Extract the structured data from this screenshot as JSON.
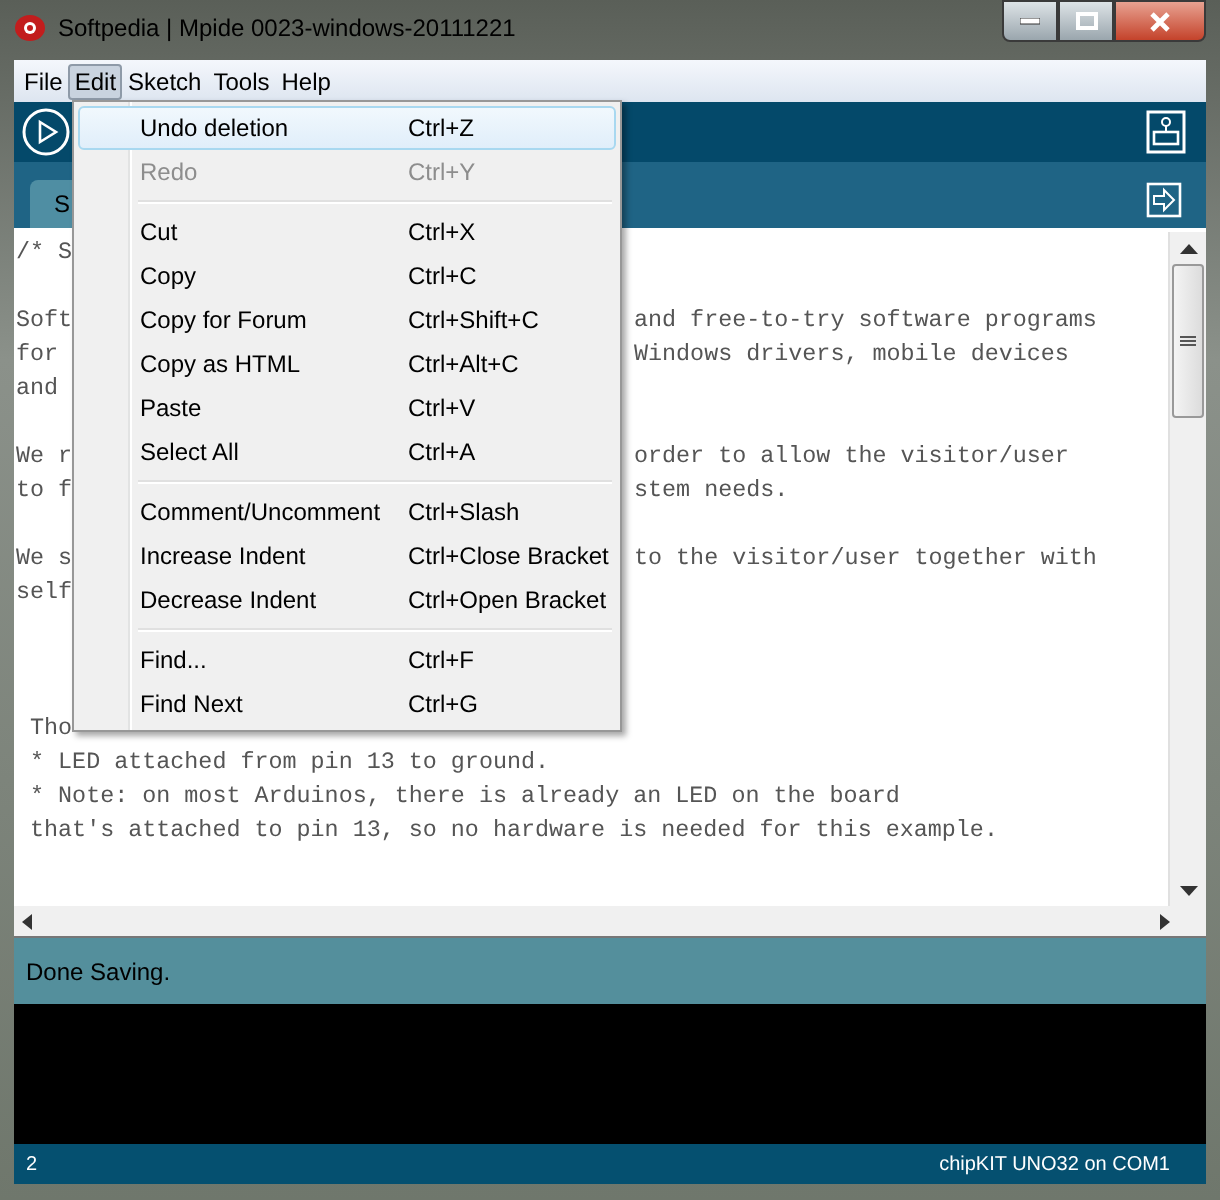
{
  "window": {
    "title": "Softpedia | Mpide 0023-windows-20111221"
  },
  "menubar": [
    {
      "label": "File",
      "selected": false
    },
    {
      "label": "Edit",
      "selected": true
    },
    {
      "label": "Sketch",
      "selected": false
    },
    {
      "label": "Tools",
      "selected": false
    },
    {
      "label": "Help",
      "selected": false
    }
  ],
  "edit_menu": {
    "groups": [
      [
        {
          "label": "Undo deletion",
          "shortcut": "Ctrl+Z",
          "disabled": false,
          "selected": true
        },
        {
          "label": "Redo",
          "shortcut": "Ctrl+Y",
          "disabled": true,
          "selected": false
        }
      ],
      [
        {
          "label": "Cut",
          "shortcut": "Ctrl+X",
          "disabled": false,
          "selected": false
        },
        {
          "label": "Copy",
          "shortcut": "Ctrl+C",
          "disabled": false,
          "selected": false
        },
        {
          "label": "Copy for Forum",
          "shortcut": "Ctrl+Shift+C",
          "disabled": false,
          "selected": false
        },
        {
          "label": "Copy as HTML",
          "shortcut": "Ctrl+Alt+C",
          "disabled": false,
          "selected": false
        },
        {
          "label": "Paste",
          "shortcut": "Ctrl+V",
          "disabled": false,
          "selected": false
        },
        {
          "label": "Select All",
          "shortcut": "Ctrl+A",
          "disabled": false,
          "selected": false
        }
      ],
      [
        {
          "label": "Comment/Uncomment",
          "shortcut": "Ctrl+Slash",
          "disabled": false,
          "selected": false
        },
        {
          "label": "Increase Indent",
          "shortcut": "Ctrl+Close Bracket",
          "disabled": false,
          "selected": false
        },
        {
          "label": "Decrease Indent",
          "shortcut": "Ctrl+Open Bracket",
          "disabled": false,
          "selected": false
        }
      ],
      [
        {
          "label": "Find...",
          "shortcut": "Ctrl+F",
          "disabled": false,
          "selected": false
        },
        {
          "label": "Find Next",
          "shortcut": "Ctrl+G",
          "disabled": false,
          "selected": false
        }
      ]
    ]
  },
  "tabs": [
    {
      "label": "S",
      "selected": true
    }
  ],
  "editor": {
    "blocks": [
      [
        {
          "left": "/* S"
        }
      ],
      [
        {
          "left": "Soft",
          "right": "and free-to-try software programs"
        },
        {
          "left": "for ",
          "right": "Windows drivers, mobile devices"
        },
        {
          "left": "and "
        }
      ],
      [
        {
          "left": "We r",
          "right": "order to allow the visitor/user"
        },
        {
          "left": "to f",
          "right": "stem needs."
        }
      ],
      [
        {
          "left": "We s",
          "right": "to the visitor/user together with"
        },
        {
          "left": "self"
        }
      ]
    ],
    "lower_block": [
      {
        "left": " Tho"
      },
      {
        "left": " * LED attached from pin 13 to ground."
      },
      {
        "left": " * Note: on most Arduinos, there is already an LED on the board"
      },
      {
        "left": " that's attached to pin 13, so no hardware is needed for this example."
      }
    ]
  },
  "status": {
    "message": "Done Saving."
  },
  "footer": {
    "line": "2",
    "board": "chipKIT UNO32 on COM1"
  }
}
